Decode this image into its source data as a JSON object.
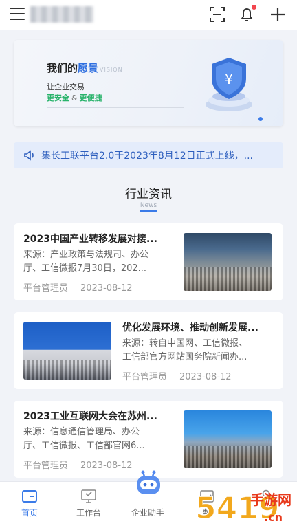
{
  "colors": {
    "accent": "#3b7be8",
    "green": "#29b36b",
    "notice_bg": "#e4ecfb",
    "dot": "#f2464f"
  },
  "topbar": {
    "icons": [
      "menu-icon",
      "scan-icon",
      "bell-icon",
      "plus-icon"
    ]
  },
  "banner": {
    "title_prefix": "我们的",
    "title_highlight": "愿景",
    "title_en": "VISION",
    "subtitle": "让企业交易",
    "tag1": "更安全",
    "amp": "&",
    "tag2": "更便捷"
  },
  "notice": {
    "text": "集长工联平台2.0于2023年8月12日正式上线，..."
  },
  "section": {
    "title": "行业资讯",
    "subtitle": "News"
  },
  "news": [
    {
      "title": "2023中国产业转移发展对接...",
      "source_line1": "来源：产业政策与法规司、办公",
      "source_line2": "厅、工信微报7月30日，202...",
      "author": "平台管理员",
      "date": "2023-08-12"
    },
    {
      "title": "优化发展环境、推动创新发展...",
      "source_line1": "来源：转自中国网、工信微报、",
      "source_line2": "工信部官方网站国务院新闻办...",
      "author": "平台管理员",
      "date": "2023-08-12"
    },
    {
      "title": "2023工业互联网大会在苏州...",
      "source_line1": "来源：信息通信管理局、办公",
      "source_line2": "厅、工信微报、工信部官网6...",
      "author": "平台管理员",
      "date": "2023-08-12"
    }
  ],
  "tabs": [
    {
      "label": "首页",
      "icon": "home-icon",
      "active": true
    },
    {
      "label": "工作台",
      "icon": "monitor-icon",
      "active": false
    },
    {
      "label": "企业助手",
      "icon": "robot-icon",
      "active": false
    },
    {
      "label": "数",
      "icon": "chart-icon",
      "active": false
    },
    {
      "label": "",
      "icon": "user-icon",
      "active": false
    }
  ],
  "watermark": {
    "brand": "5419",
    "text": "手游网",
    "url": ".cn"
  }
}
